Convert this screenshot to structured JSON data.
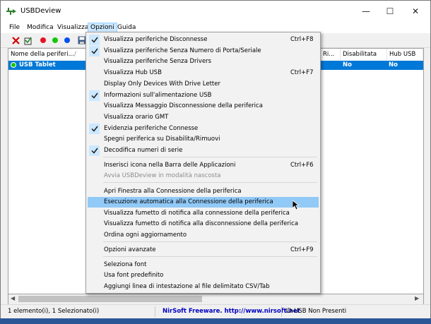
{
  "window": {
    "title": "USBDeview",
    "controls": {
      "minimize": "—",
      "maximize": "☐",
      "close": "✕"
    }
  },
  "menubar": [
    "File",
    "Modifica",
    "Visualizza",
    "Opzioni",
    "Guida"
  ],
  "toolbar": {
    "icons": [
      "delete-icon",
      "uninstall-icon",
      "disconnect-icon",
      "connect-icon",
      "properties-icon",
      "save-icon"
    ],
    "colors": {
      "red": "#e81123",
      "green": "#16c60c",
      "blue": "#0050ef"
    }
  },
  "list": {
    "columns": [
      "Nome della periferi...",
      "Ri...",
      "Disabilitata",
      "Hub USB"
    ],
    "sort_indicator": "/",
    "rows": [
      {
        "name": "USB Tablet",
        "disabilitata": "No",
        "hub_usb": "No"
      }
    ]
  },
  "options_menu": {
    "items": [
      {
        "label": "Visualizza periferiche Disconnesse",
        "shortcut": "Ctrl+F8",
        "checked": true
      },
      {
        "label": "Visualizza periferiche Senza Numero di Porta/Seriale",
        "shortcut": "",
        "checked": true
      },
      {
        "label": "Visualizza periferiche Senza Drivers",
        "shortcut": "",
        "checked": false
      },
      {
        "label": "Visualizza Hub USB",
        "shortcut": "Ctrl+F7",
        "checked": false
      },
      {
        "label": "Display Only Devices With Drive Letter",
        "shortcut": "",
        "checked": false
      },
      {
        "label": "Informazioni sull'alimentazione USB",
        "shortcut": "",
        "checked": true
      },
      {
        "label": "Visualizza Messaggio Disconnessione della periferica",
        "shortcut": "",
        "checked": false
      },
      {
        "label": "Visualizza orario GMT",
        "shortcut": "",
        "checked": false
      },
      {
        "label": "Evidenzia periferiche Connesse",
        "shortcut": "",
        "checked": true
      },
      {
        "label": "Spegni periferica su Disabilita/Rimuovi",
        "shortcut": "",
        "checked": false
      },
      {
        "label": "Decodifica numeri di serie",
        "shortcut": "",
        "checked": true
      },
      {
        "label": "Inserisci icona nella Barra delle Applicazioni",
        "shortcut": "Ctrl+F6",
        "checked": false
      },
      {
        "label": "Avvia USBDeview in modalità nascosta",
        "shortcut": "",
        "checked": false,
        "disabled": true
      },
      {
        "label": "Apri Finestra alla Connessione della periferica",
        "shortcut": "",
        "checked": false
      },
      {
        "label": "Esecuzione automatica alla Connessione della periferica",
        "shortcut": "",
        "checked": false,
        "highlighted": true
      },
      {
        "label": "Visualizza fumetto di notifica alla connessione della periferica",
        "shortcut": "",
        "checked": false
      },
      {
        "label": "Visualizza fumetto di notifica alla disconnessione della periferica",
        "shortcut": "",
        "checked": false
      },
      {
        "label": "Ordina ogni aggiornamento",
        "shortcut": "",
        "checked": false
      },
      {
        "label": "Opzioni avanzate",
        "shortcut": "Ctrl+F9",
        "checked": false
      },
      {
        "label": "Seleziona font",
        "shortcut": "",
        "checked": false
      },
      {
        "label": "Usa font predefinito",
        "shortcut": "",
        "checked": false
      },
      {
        "label": "Aggiungi linea di intestazione al file delimitato CSV/Tab",
        "shortcut": "",
        "checked": false
      }
    ]
  },
  "status": {
    "count": "1 elemento(i), 1 Selezionato(i)",
    "credit": "NirSoft Freeware.  http://www.nirsoft.net",
    "filter": "ID-USB Non Presenti"
  },
  "colors": {
    "selection": "#0078d7",
    "menu_highlight": "#91c9f7",
    "check_bg": "#cce8ff",
    "credit_text": "#0000c0"
  }
}
